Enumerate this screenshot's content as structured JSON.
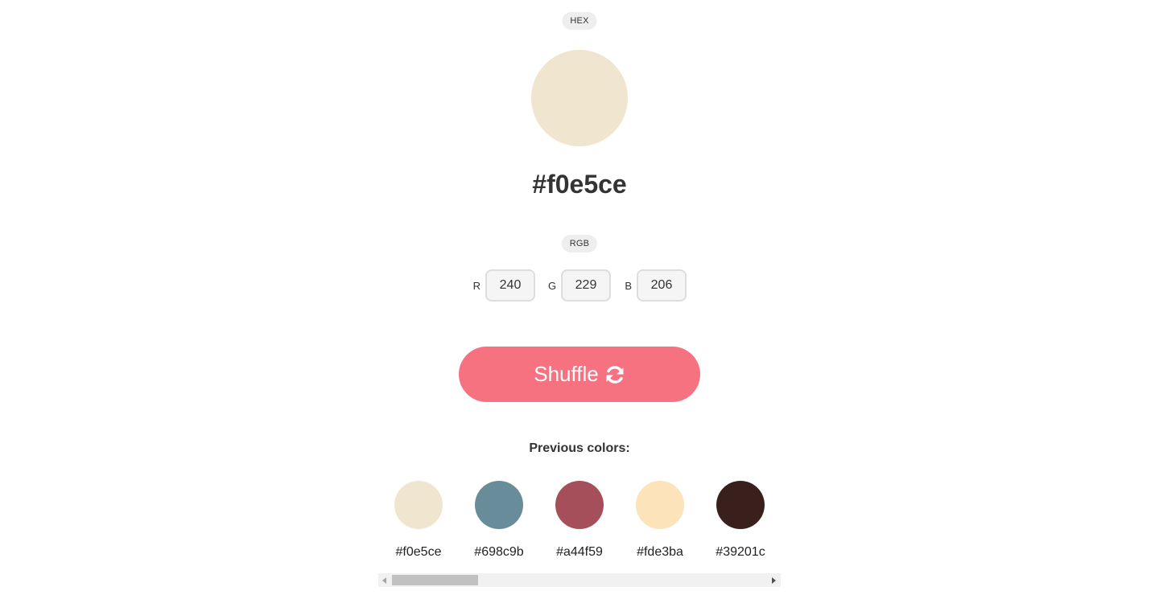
{
  "labels": {
    "hex_badge": "HEX",
    "rgb_badge": "RGB",
    "r": "R",
    "g": "G",
    "b": "B",
    "previous_colors": "Previous colors:"
  },
  "current_color": {
    "hex": "#f0e5ce",
    "r": "240",
    "g": "229",
    "b": "206"
  },
  "shuffle_button": {
    "label": "Shuffle",
    "icon": "refresh-icon",
    "color": "#f77281"
  },
  "history": [
    {
      "hex": "#f0e5ce"
    },
    {
      "hex": "#698c9b"
    },
    {
      "hex": "#a44f59"
    },
    {
      "hex": "#fde3ba"
    },
    {
      "hex": "#39201c"
    }
  ],
  "scrollbar": {
    "position": 0.0,
    "visible_fraction": 0.23
  }
}
